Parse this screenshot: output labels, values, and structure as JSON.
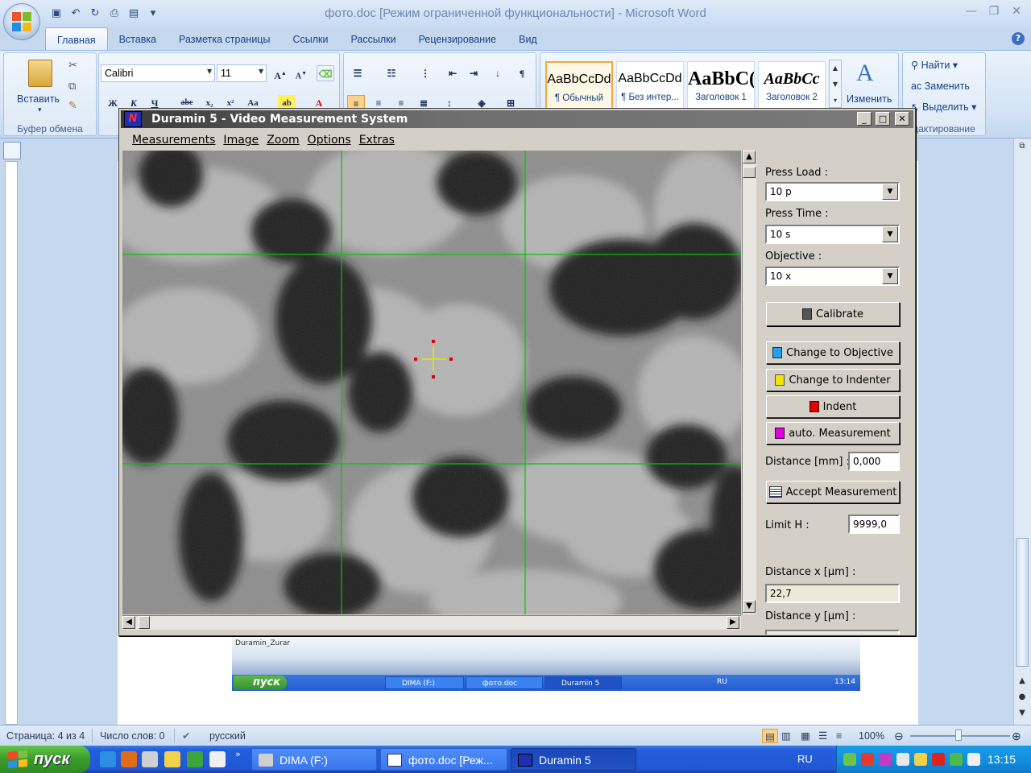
{
  "word": {
    "title": "фото.doc [Режим ограниченной функциональности] - Microsoft Word",
    "tabs": [
      "Главная",
      "Вставка",
      "Разметка страницы",
      "Ссылки",
      "Рассылки",
      "Рецензирование",
      "Вид"
    ],
    "clipboard": {
      "paste_label": "Вставить",
      "group_label": "Буфер обмена"
    },
    "font": {
      "name": "Calibri",
      "size": "11"
    },
    "styles": [
      {
        "sample": "AaBbCcDd",
        "name": "¶ Обычный"
      },
      {
        "sample": "AaBbCcDd",
        "name": "¶ Без интер..."
      },
      {
        "sample": "AaBbC(",
        "name": "Заголовок 1"
      },
      {
        "sample": "AaBbCc",
        "name": "Заголовок 2"
      }
    ],
    "change_styles": "Изменить",
    "editing": {
      "find": "Найти",
      "replace": "Заменить",
      "select": "Выделить",
      "group_label": "дактирование"
    },
    "status": {
      "page": "Страница: 4 из 4",
      "words": "Число слов: 0",
      "language": "русский",
      "zoom": "100%"
    },
    "embedded": {
      "label": "Duramin_Zurar",
      "start": "пуск",
      "tasks": [
        "DIMA (F:)",
        "фото.doc [Реж...",
        "Duramin 5"
      ],
      "lang": "RU",
      "clock": "13:14"
    }
  },
  "duramin": {
    "title": "Duramin 5 - Video Measurement System",
    "menu": [
      "Measurements",
      "Image",
      "Zoom",
      "Options",
      "Extras"
    ],
    "panel": {
      "press_load_label": "Press Load :",
      "press_load_value": "10 p",
      "press_time_label": "Press Time :",
      "press_time_value": "10 s",
      "objective_label": "Objective :",
      "objective_value": "10 x",
      "calibrate": "Calibrate",
      "change_objective": "Change to Objective",
      "change_indenter": "Change to Indenter",
      "indent": "Indent",
      "auto_measurement": "auto. Measurement",
      "distance_label": "Distance [mm] :",
      "distance_value": "0,000",
      "accept_measurement": "Accept Measurement",
      "limit_label": "Limit H :",
      "limit_value": "9999,0",
      "distance_x_label": "Distance x [µm] :",
      "distance_x_value": "22,7",
      "distance_y_label": "Distance y [µm] :"
    }
  },
  "taskbar": {
    "start": "пуск",
    "tasks": [
      {
        "label": "DIMA (F:)"
      },
      {
        "label": "фото.doc [Реж..."
      },
      {
        "label": "Duramin 5"
      }
    ],
    "lang": "RU",
    "clock": "13:15"
  },
  "colors": {
    "crosshair": "#00c800",
    "marker": "#e00000",
    "cursor": "#e6e600"
  }
}
